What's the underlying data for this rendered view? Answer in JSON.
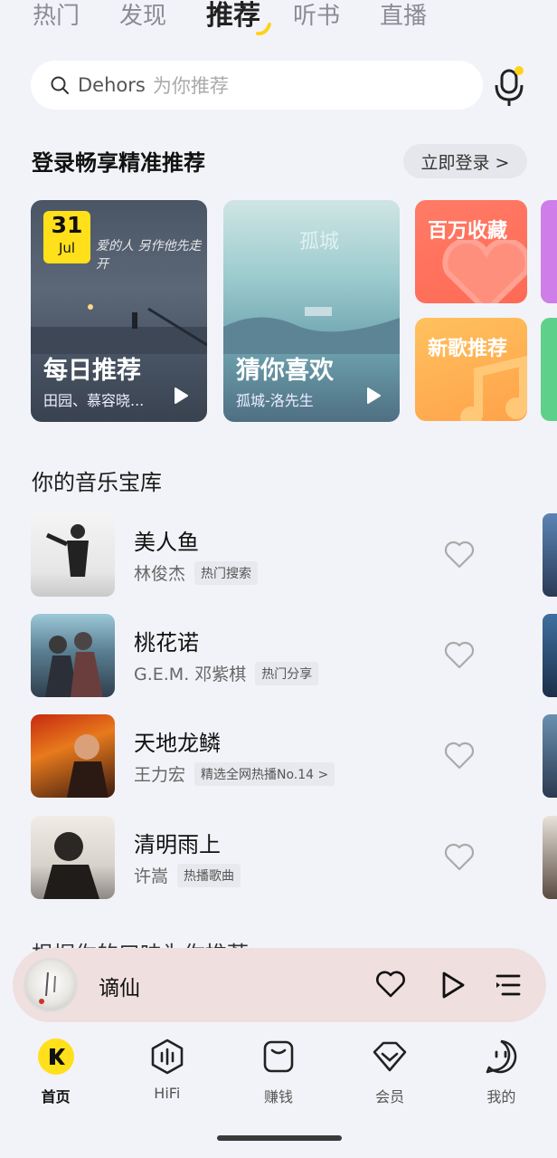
{
  "top_tabs": [
    "热门",
    "发现",
    "推荐",
    "听书",
    "直播"
  ],
  "active_tab_index": 2,
  "search": {
    "query": "Dehors",
    "hint": "为你推荐"
  },
  "login": {
    "title": "登录畅享精准推荐",
    "button": "立即登录 >"
  },
  "cards": {
    "daily": {
      "title": "每日推荐",
      "subtitle": "田园、慕容晓...",
      "date_day": "31",
      "date_month": "Jul",
      "art_text": "爱的人 另作他先走开"
    },
    "guess": {
      "title": "猜你喜欢",
      "subtitle": "孤城-洛先生",
      "art_text": "孤城"
    },
    "hot": {
      "title": "百万收藏"
    },
    "new": {
      "title": "新歌推荐"
    }
  },
  "library": {
    "title": "你的音乐宝库",
    "songs": [
      {
        "title": "美人鱼",
        "artist": "林俊杰",
        "tag": "热门搜索"
      },
      {
        "title": "桃花诺",
        "artist": "G.E.M. 邓紫棋",
        "tag": "热门分享"
      },
      {
        "title": "天地龙鳞",
        "artist": "王力宏",
        "tag": "精选全网热播No.14 >"
      },
      {
        "title": "清明雨上",
        "artist": "许嵩",
        "tag": "热播歌曲"
      }
    ]
  },
  "next_section_peek": "根据你的口味为你推荐",
  "player": {
    "title": "谪仙"
  },
  "nav": [
    {
      "label": "首页",
      "icon": "home-icon"
    },
    {
      "label": "HiFi",
      "icon": "hifi-icon"
    },
    {
      "label": "赚钱",
      "icon": "wallet-icon"
    },
    {
      "label": "会员",
      "icon": "vip-icon"
    },
    {
      "label": "我的",
      "icon": "profile-icon"
    }
  ],
  "colors": {
    "accent": "#ffe01b",
    "hot_card": "#ff6a55",
    "new_card": "#ffa24a",
    "player_bg": "#f0dfdf"
  }
}
